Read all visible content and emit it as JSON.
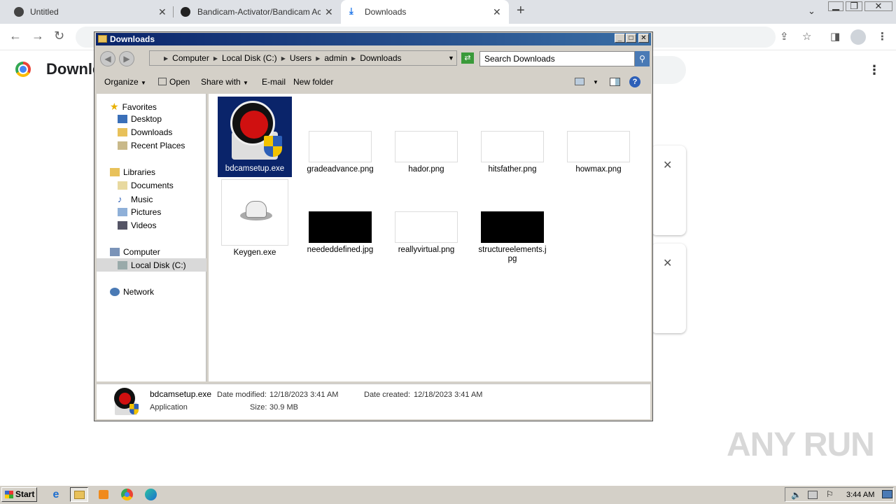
{
  "browser": {
    "tabs": [
      {
        "label": "Untitled",
        "active": false
      },
      {
        "label": "Bandicam-Activator/Bandicam Activa",
        "active": false
      },
      {
        "label": "Downloads",
        "active": true
      }
    ],
    "page_title": "Downle"
  },
  "explorer": {
    "title": "Downloads",
    "breadcrumb": [
      "Computer",
      "Local Disk (C:)",
      "Users",
      "admin",
      "Downloads"
    ],
    "search_placeholder": "Search Downloads",
    "commands": {
      "organize": "Organize",
      "open": "Open",
      "share_with": "Share with",
      "email": "E-mail",
      "new_folder": "New folder"
    },
    "nav": {
      "favorites": "Favorites",
      "desktop": "Desktop",
      "downloads": "Downloads",
      "recent_places": "Recent Places",
      "libraries": "Libraries",
      "documents": "Documents",
      "music": "Music",
      "pictures": "Pictures",
      "videos": "Videos",
      "computer": "Computer",
      "local_disk": "Local Disk (C:)",
      "network": "Network"
    },
    "files": [
      {
        "name": "bdcamsetup.exe",
        "selected": true
      },
      {
        "name": "gradeadvance.png"
      },
      {
        "name": "hador.png"
      },
      {
        "name": "hitsfather.png"
      },
      {
        "name": "howmax.png"
      },
      {
        "name": "Keygen.exe"
      },
      {
        "name": "neededdefined.jpg"
      },
      {
        "name": "reallyvirtual.png"
      },
      {
        "name": "structureelements.jpg"
      }
    ],
    "details": {
      "filename": "bdcamsetup.exe",
      "type": "Application",
      "modified_label": "Date modified:",
      "modified": "12/18/2023 3:41 AM",
      "created_label": "Date created:",
      "created": "12/18/2023 3:41 AM",
      "size_label": "Size:",
      "size": "30.9 MB"
    }
  },
  "taskbar": {
    "start": "Start",
    "clock": "3:44 AM"
  },
  "watermark": "ANY RUN"
}
